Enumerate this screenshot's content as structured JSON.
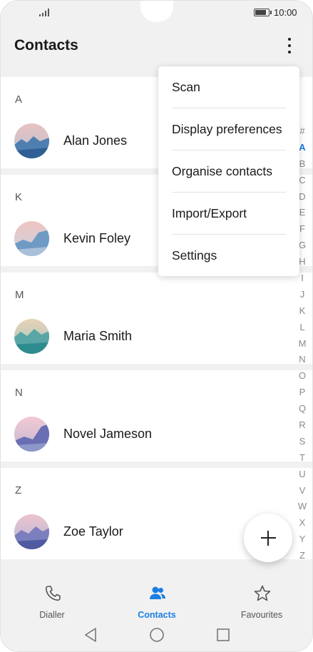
{
  "status_bar": {
    "time": "10:00",
    "battery_level": 0.9
  },
  "header": {
    "title": "Contacts",
    "more_icon": "more-vertical-icon"
  },
  "contacts": [
    {
      "letter": "A",
      "name": "Alan Jones"
    },
    {
      "letter": "K",
      "name": "Kevin Foley"
    },
    {
      "letter": "M",
      "name": "Maria Smith"
    },
    {
      "letter": "N",
      "name": "Novel Jameson"
    },
    {
      "letter": "Z",
      "name": "Zoe Taylor"
    }
  ],
  "menu": {
    "items": [
      {
        "label": "Scan"
      },
      {
        "label": "Display preferences"
      },
      {
        "label": "Organise contacts"
      },
      {
        "label": "Import/Export"
      },
      {
        "label": "Settings"
      }
    ]
  },
  "index_bar": {
    "letters": [
      "#",
      "A",
      "B",
      "C",
      "D",
      "E",
      "F",
      "G",
      "H",
      "I",
      "J",
      "K",
      "L",
      "M",
      "N",
      "O",
      "P",
      "Q",
      "R",
      "S",
      "T",
      "U",
      "V",
      "W",
      "X",
      "Y",
      "Z"
    ],
    "active": "A"
  },
  "fab": {
    "icon": "plus-icon"
  },
  "bottom_nav": {
    "tabs": [
      {
        "label": "Dialler",
        "icon": "phone-icon"
      },
      {
        "label": "Contacts",
        "icon": "contacts-icon",
        "active": true
      },
      {
        "label": "Favourites",
        "icon": "star-icon"
      }
    ]
  },
  "colors": {
    "accent": "#1a7ee3",
    "background": "#f1f1f1",
    "card": "#ffffff"
  }
}
